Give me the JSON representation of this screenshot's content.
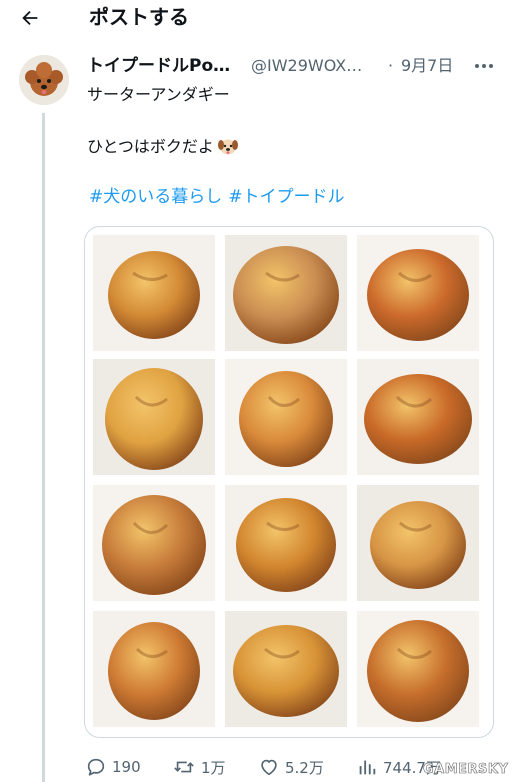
{
  "header": {
    "title": "ポストする",
    "back_icon": "arrow-left-icon"
  },
  "post": {
    "author_name": "トイプードルPo…",
    "handle": "@IW29WOX…",
    "separator": "·",
    "date": "9月7日",
    "more_icon": "more-horizontal-icon",
    "line1": "サーターアンダギー",
    "line2": "ひとつはボクだよ",
    "emoji": "dog-face-emoji",
    "hashtags": [
      "#犬のいる暮らし",
      "#トイプードル"
    ]
  },
  "media": {
    "description_count": 12,
    "colors": [
      "#d38a35",
      "#c98d52",
      "#cc6a2c",
      "#e0a241",
      "#d98a3a",
      "#c96a28",
      "#c77c3a",
      "#d2862e",
      "#d79545",
      "#cf7b34",
      "#d89336",
      "#c66e2c"
    ]
  },
  "actions": {
    "replies": "190",
    "reposts": "1万",
    "likes": "5.2万",
    "views": "744.7万"
  },
  "watermark": "GAMERSKY",
  "colors": {
    "link": "#1d9bf0",
    "muted": "#536471",
    "border": "#cfd9de"
  }
}
